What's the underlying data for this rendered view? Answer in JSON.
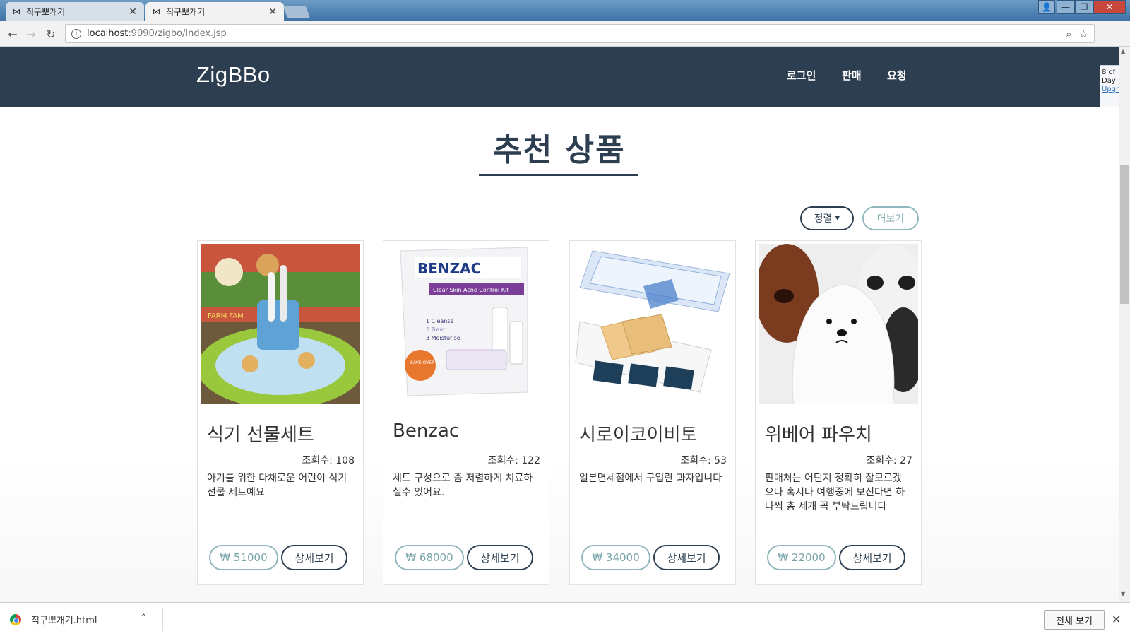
{
  "browser": {
    "tabs": [
      {
        "title": "직구뽀개기",
        "active": false
      },
      {
        "title": "직구뽀개기",
        "active": true
      }
    ],
    "url_host": "localhost",
    "url_path": ":9090/zigbo/index.jsp"
  },
  "site": {
    "brand": "ZigBBo",
    "nav": [
      "로그인",
      "판매",
      "요청"
    ]
  },
  "side_widget": {
    "line1": "8 of",
    "line2": "Day",
    "link": "Upgr"
  },
  "section": {
    "title": "추천 상품",
    "sort_label": "정렬",
    "more_label": "더보기"
  },
  "products": [
    {
      "name": "식기 선물세트",
      "views": "조회수: 108",
      "desc": "아기를 위한 다채로운 어린이 식기 선물 세트예요",
      "price": "₩ 51000",
      "detail": "상세보기"
    },
    {
      "name": "Benzac",
      "views": "조회수: 122",
      "desc": "세트 구성으로 좀 저렴하게 치료하실수 있어요.",
      "price": "₩ 68000",
      "detail": "상세보기"
    },
    {
      "name": "시로이코이비토",
      "views": "조회수: 53",
      "desc": "일본면세점에서 구입란 과자입니다",
      "price": "₩ 34000",
      "detail": "상세보기"
    },
    {
      "name": "위베어 파우치",
      "views": "조회수: 27",
      "desc": "판매처는 어딘지 정확히 잘모르겠으나 혹시나 여행중에 보신다면 하나씩 총 세개 꼭 부탁드립니다",
      "price": "₩ 22000",
      "detail": "상세보기"
    }
  ],
  "product_images": {
    "benzac_brand": "BENZAC",
    "benzac_kit": "Clear Skin Acne Control Kit",
    "benzac_steps": [
      "1 Cleanse",
      "2 Treat",
      "3 Moisturise"
    ],
    "benzac_save": "SAVE OVER 25%",
    "tableware_text": "FARM FAM"
  },
  "download_bar": {
    "file": "직구뽀개기.html",
    "show_all": "전체 보기"
  },
  "colors": {
    "header_bg": "#2c3e50",
    "accent_teal": "#8fb7bd"
  }
}
